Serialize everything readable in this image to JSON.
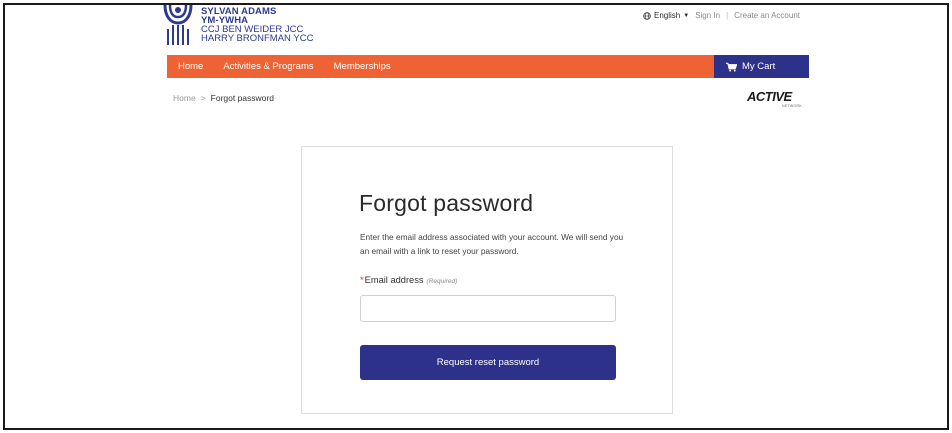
{
  "brand": {
    "line1": "SYLVAN ADAMS",
    "line2": "YM-YWHA",
    "line3": "CCJ BEN WEIDER JCC",
    "line4": "HARRY BRONFMAN YCC",
    "color": "#2d3b8e"
  },
  "utility": {
    "language": "English",
    "language_icon": "globe-icon",
    "sign_in": "Sign In",
    "separator": "|",
    "create_account": "Create an Account"
  },
  "nav": {
    "items": [
      "Home",
      "Activities & Programs",
      "Memberships"
    ],
    "cart_label": "My Cart",
    "cart_icon": "shopping-cart-icon",
    "color": "#ef6234",
    "cart_color": "#2d318a"
  },
  "breadcrumb": {
    "home": "Home",
    "separator": ">",
    "current": "Forgot password"
  },
  "partner": {
    "name": "ACTIVE",
    "sub": "NETWORK"
  },
  "form": {
    "title": "Forgot password",
    "description": "Enter the email address associated with your account. We will send you an email with a link to reset your password.",
    "required_star": "*",
    "email_label": "Email address",
    "required_note": "(Required)",
    "email_value": "",
    "submit_label": "Request reset password",
    "button_color": "#2d318a"
  }
}
